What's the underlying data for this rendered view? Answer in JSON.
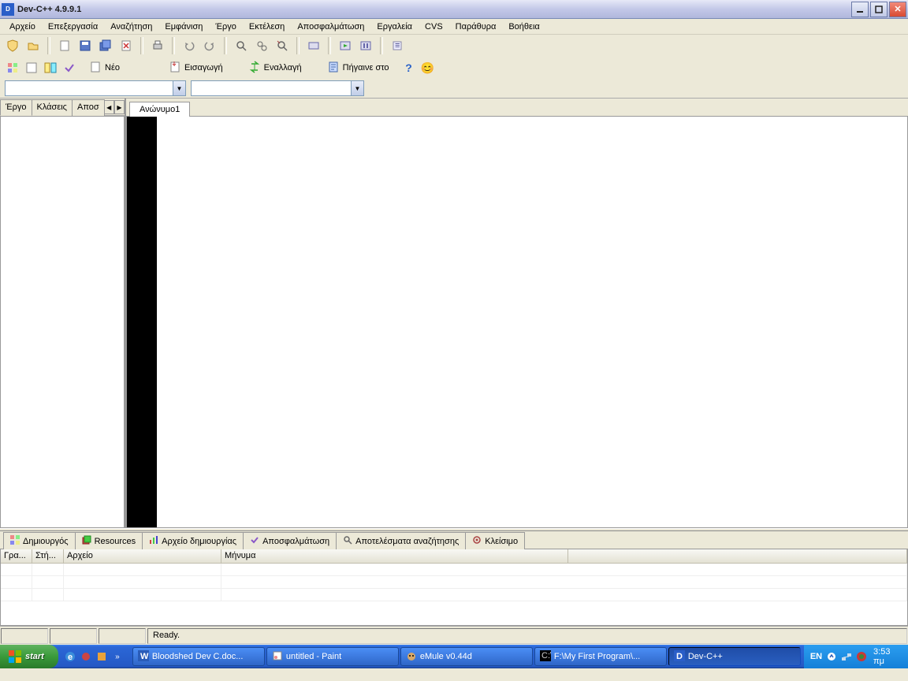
{
  "window": {
    "title": "Dev-C++ 4.9.9.1"
  },
  "menus": [
    "Αρχείο",
    "Επεξεργασία",
    "Αναζήτηση",
    "Εμφάνιση",
    "Έργο",
    "Εκτέλεση",
    "Αποσφαλμάτωση",
    "Εργαλεία",
    "CVS",
    "Παράθυρα",
    "Βοήθεια"
  ],
  "toolbar2": {
    "new": "Νέο",
    "insert": "Εισαγωγή",
    "toggle": "Εναλλαγή",
    "goto": "Πήγαινε στο"
  },
  "side_tabs": {
    "t1": "Έργο",
    "t2": "Κλάσεις",
    "t3": "Αποσ"
  },
  "editor_tab": "Ανώνυμο1",
  "bottom_tabs": {
    "t1": "Δημιουργός",
    "t2": "Resources",
    "t3": "Αρχείο δημιουργίας",
    "t4": "Αποσφαλμάτωση",
    "t5": "Αποτελέσματα αναζήτησης",
    "t6": "Κλείσιμο"
  },
  "bottom_headers": {
    "c1": "Γρα...",
    "c2": "Στή...",
    "c3": "Αρχείο",
    "c4": "Μήνυμα"
  },
  "status": {
    "ready": "Ready."
  },
  "taskbar": {
    "start": "start",
    "items": [
      {
        "label": "Bloodshed Dev C.doc..."
      },
      {
        "label": "untitled - Paint"
      },
      {
        "label": "eMule v0.44d"
      },
      {
        "label": "F:\\My First Program\\..."
      },
      {
        "label": "Dev-C++"
      }
    ],
    "lang": "EN",
    "clock": "3:53 πμ"
  }
}
